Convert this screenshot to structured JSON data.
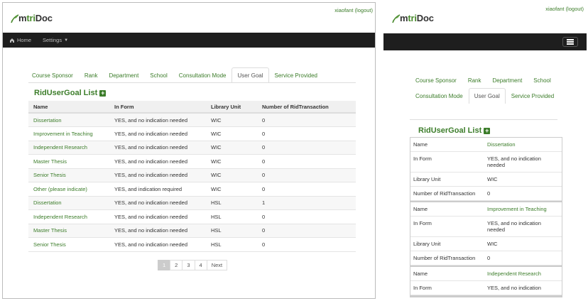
{
  "user": {
    "name": "xiaofant",
    "logout": "(logout)"
  },
  "logo": {
    "brand_prefix": "m",
    "brand_green": "tri",
    "brand_suffix": "Doc"
  },
  "nav": {
    "home": "Home",
    "settings": "Settings"
  },
  "tabs": [
    "Course Sponsor",
    "Rank",
    "Department",
    "School",
    "Consultation Mode",
    "User Goal",
    "Service Provided"
  ],
  "active_tab": "User Goal",
  "list_title": "RidUserGoal List",
  "columns": [
    "Name",
    "In Form",
    "Library Unit",
    "Number of RidTransaction"
  ],
  "rows": [
    [
      "Dissertation",
      "YES, and no indication needed",
      "WIC",
      "0"
    ],
    [
      "Improvement in Teaching",
      "YES, and no indication needed",
      "WIC",
      "0"
    ],
    [
      "Independent Research",
      "YES, and no indication needed",
      "WIC",
      "0"
    ],
    [
      "Master Thesis",
      "YES, and no indication needed",
      "WIC",
      "0"
    ],
    [
      "Senior Thesis",
      "YES, and no indication needed",
      "WIC",
      "0"
    ],
    [
      "Other (please indicate)",
      "YES, and indication required",
      "WIC",
      "0"
    ],
    [
      "Dissertation",
      "YES, and no indication needed",
      "HSL",
      "1"
    ],
    [
      "Independent Research",
      "YES, and no indication needed",
      "HSL",
      "0"
    ],
    [
      "Master Thesis",
      "YES, and no indication needed",
      "HSL",
      "0"
    ],
    [
      "Senior Thesis",
      "YES, and no indication needed",
      "HSL",
      "0"
    ]
  ],
  "pager": {
    "pages": [
      "1",
      "2",
      "3",
      "4"
    ],
    "next": "Next",
    "current": "1"
  },
  "mobile_labels": {
    "name": "Name",
    "in_form": "In Form",
    "library_unit": "Library Unit",
    "count": "Number of RidTransaction"
  },
  "mobile_cards": [
    {
      "name": "Dissertation",
      "in_form": "YES, and no indication needed",
      "library_unit": "WIC",
      "count": "0"
    },
    {
      "name": "Improvement in Teaching",
      "in_form": "YES, and no indication needed",
      "library_unit": "WIC",
      "count": "0"
    },
    {
      "name": "Independent Research",
      "in_form": "YES, and no indication",
      "library_unit": "",
      "count": ""
    }
  ],
  "colors": {
    "accent": "#3c7d2a",
    "navbar": "#1e1e1e"
  }
}
